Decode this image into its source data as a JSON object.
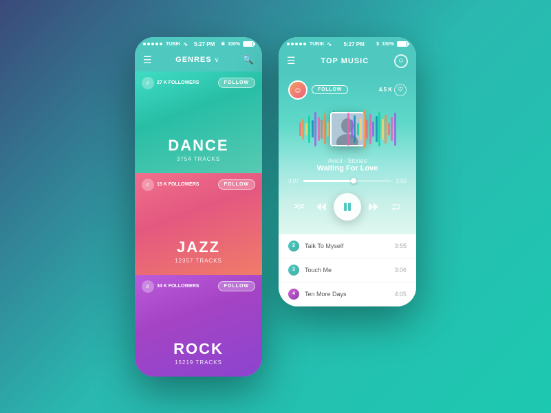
{
  "background": "#2a9a98",
  "left_phone": {
    "status": {
      "carrier": "TUBIK",
      "time": "5:27 PM",
      "battery": "100%"
    },
    "nav": {
      "menu_icon": "☰",
      "title": "GENRES",
      "chevron": "∨",
      "search_icon": "🔍"
    },
    "genres": [
      {
        "id": "dance",
        "name": "DANCE",
        "tracks": "3754 TRACKS",
        "followers": "27 K FOLLOWERS",
        "follow_label": "FOLLOW",
        "color_start": "#40e0c8",
        "color_end": "#20c0a0"
      },
      {
        "id": "jazz",
        "name": "JAZZ",
        "tracks": "12357 TRACKS",
        "followers": "15 K FOLLOWERS",
        "follow_label": "FOLLOW",
        "color_start": "#f07090",
        "color_end": "#f06040"
      },
      {
        "id": "rock",
        "name": "ROCK",
        "tracks": "15219 TRACKS",
        "followers": "34 K FOLLOWERS",
        "follow_label": "FOLLOW",
        "color_start": "#c060e0",
        "color_end": "#8040c0"
      }
    ]
  },
  "right_phone": {
    "status": {
      "carrier": "TUBIK",
      "time": "5:27 PM",
      "battery": "100%"
    },
    "nav": {
      "menu_icon": "☰",
      "title": "TOP MUSIC"
    },
    "player": {
      "artist_follow_label": "FOLLOW",
      "likes": "4.5 K",
      "track_artist": "Avicii - Stories",
      "track_name": "Waiting For Love",
      "time_current": "3:07",
      "time_total": "3:50",
      "progress_pct": 60
    },
    "playlist": [
      {
        "num": "2",
        "name": "Talk To Myself",
        "duration": "3:55"
      },
      {
        "num": "3",
        "name": "Touch Me",
        "duration": "3:06"
      },
      {
        "num": "4",
        "name": "Ten More Days",
        "duration": "4:05"
      }
    ]
  }
}
